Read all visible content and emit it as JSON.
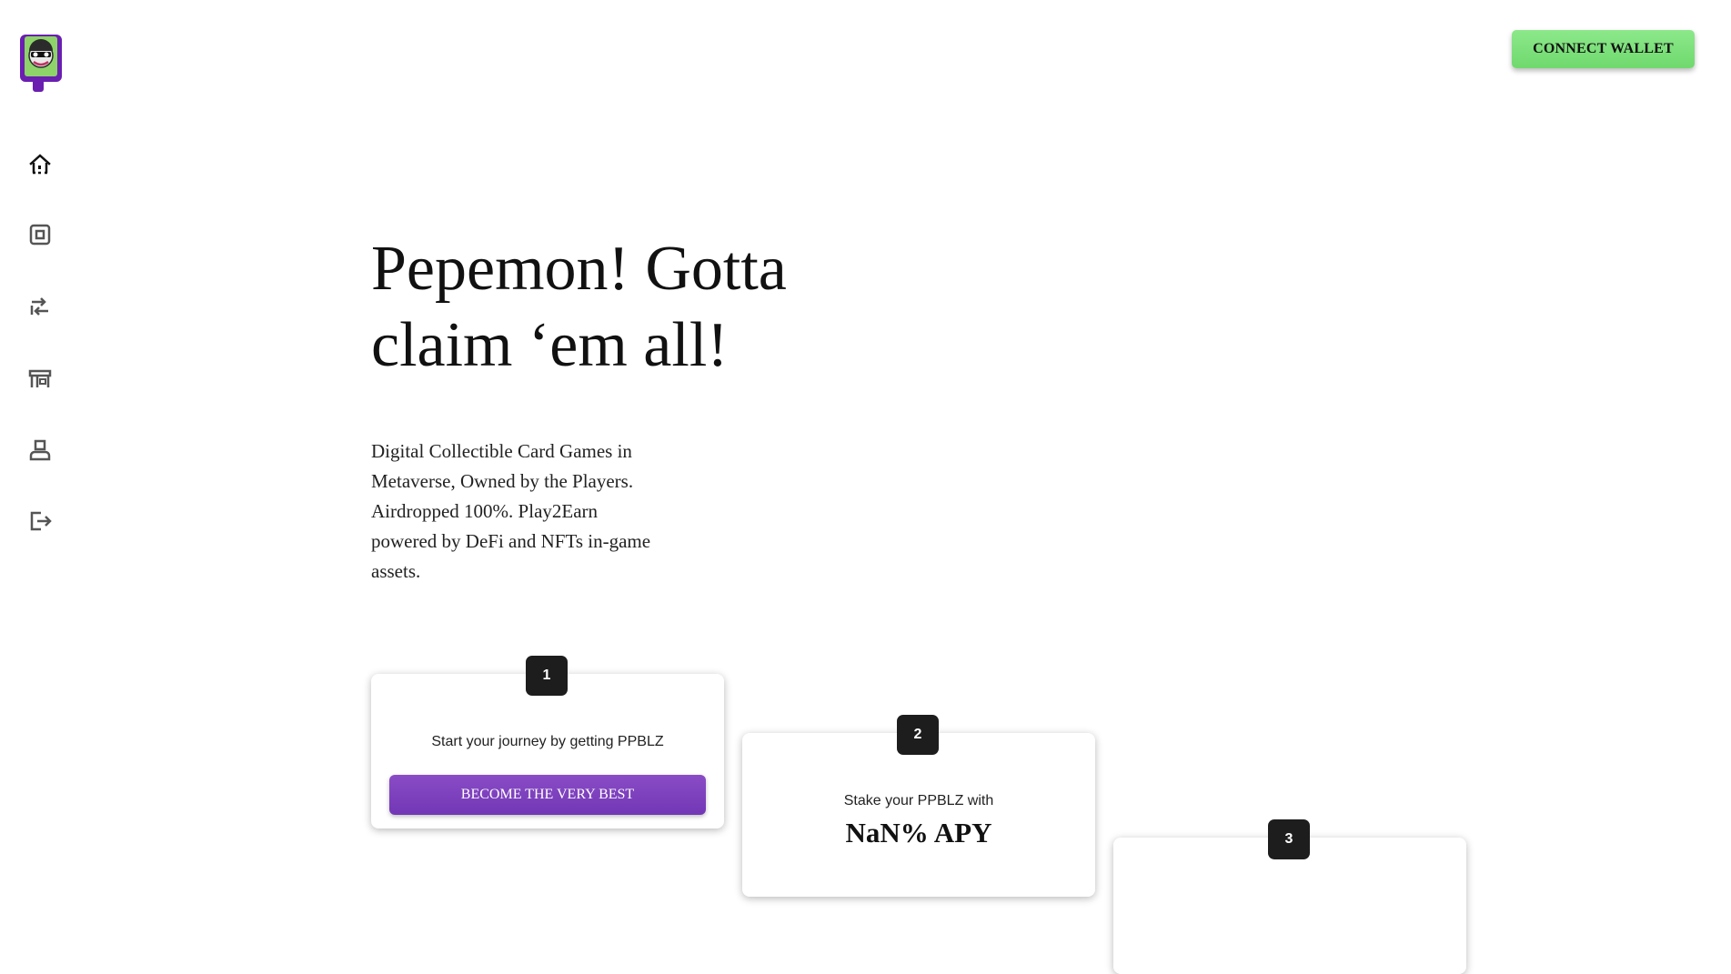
{
  "header": {
    "connect_label": "CONNECT WALLET"
  },
  "sidebar": {
    "items": [
      {
        "icon": "home-icon"
      },
      {
        "icon": "card-icon"
      },
      {
        "icon": "swap-icon"
      },
      {
        "icon": "store-icon"
      },
      {
        "icon": "profile-icon"
      },
      {
        "icon": "logout-icon"
      }
    ]
  },
  "hero": {
    "title": "Pepemon! Gotta claim ‘em all!",
    "subtitle": "Digital Collectible Card Games in Metaverse, Owned by the Players. Airdropped 100%. Play2Earn powered by DeFi and NFTs in-game assets."
  },
  "steps": [
    {
      "number": "1",
      "text": "Start your journey by getting PPBLZ",
      "button": "BECOME THE VERY BEST"
    },
    {
      "number": "2",
      "text": "Stake your PPBLZ with",
      "apy": "NaN% APY"
    },
    {
      "number": "3"
    }
  ],
  "colors": {
    "accent_purple": "#7a3fba",
    "connect_green": "#7ee07c",
    "badge_dark": "#1d1d1d"
  }
}
